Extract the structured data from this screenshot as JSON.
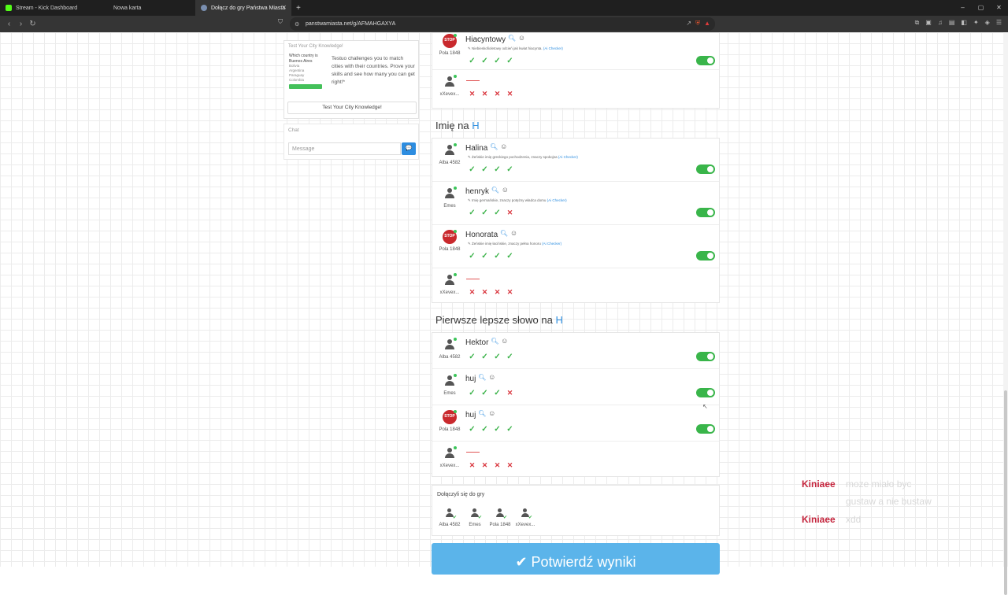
{
  "browser": {
    "tabs": [
      {
        "title": "Stream - Kick Dashboard",
        "favicon_color": "#53fc18"
      },
      {
        "title": "Nowa karta",
        "favicon_color": ""
      },
      {
        "title": "Dołącz do gry Państwa Miasta",
        "favicon_color": "#7a8fb0"
      }
    ],
    "new_tab": "+",
    "url": "panstwamiasta.net/g/AFMAHGAXYA",
    "window_controls": [
      "–",
      "▢",
      "✕"
    ]
  },
  "promo": {
    "title": "Test Your City Knowledge!",
    "thumb_question": "Which country is Buenos Aires",
    "thumb_options": [
      "Bolivia",
      "Argentina",
      "Paraguay",
      "Colombia"
    ],
    "description": "Testuo challenges you to match cities with their countries. Prove your skills and see how many you can get right!*",
    "button": "Test Your City Knowledge!"
  },
  "chat": {
    "title": "Chat",
    "placeholder": "Message",
    "send_icon": "💬"
  },
  "sections": [
    {
      "title": "",
      "letter": "",
      "rows": [
        {
          "player": "Pola 1848",
          "avatar": "stop",
          "word": "Hiacyntowy",
          "description": "Niebieskofioletowy odcień jak kwiat hiacynta.",
          "ai": "(Ai Checker)",
          "marks": [
            "ok",
            "ok",
            "ok",
            "ok"
          ],
          "toggle": true
        },
        {
          "player": "xXevex...",
          "avatar": "user",
          "word": "",
          "description": "",
          "ai": "",
          "marks": [
            "no",
            "no",
            "no",
            "no"
          ],
          "toggle": false
        }
      ]
    },
    {
      "title": "Imię na ",
      "letter": "H",
      "rows": [
        {
          "player": "Alba 4582",
          "avatar": "user",
          "word": "Halina",
          "description": "Żeńskie imię greckiego pochodzenia, znaczy spokojna",
          "ai": "(Ai Checker)",
          "marks": [
            "ok",
            "ok",
            "ok",
            "ok"
          ],
          "toggle": true
        },
        {
          "player": "Emes",
          "avatar": "user",
          "word": "henryk",
          "description": "Imię germańskie, znaczy potężny władca domu",
          "ai": "(Ai Checker)",
          "marks": [
            "ok",
            "ok",
            "ok",
            "no"
          ],
          "toggle": true
        },
        {
          "player": "Pola 1848",
          "avatar": "stop",
          "word": "Honorata",
          "description": "Żeńskie imię łacińskie, znaczy pełna honoru",
          "ai": "(Ai Checker)",
          "marks": [
            "ok",
            "ok",
            "ok",
            "ok"
          ],
          "toggle": true
        },
        {
          "player": "xXevex...",
          "avatar": "user",
          "word": "",
          "description": "",
          "ai": "",
          "marks": [
            "no",
            "no",
            "no",
            "no"
          ],
          "toggle": false
        }
      ]
    },
    {
      "title": "Pierwsze lepsze słowo na ",
      "letter": "H",
      "rows": [
        {
          "player": "Alba 4582",
          "avatar": "user",
          "word": "Hektor",
          "description": "",
          "ai": "",
          "marks": [
            "ok",
            "ok",
            "ok",
            "ok"
          ],
          "toggle": true
        },
        {
          "player": "Emes",
          "avatar": "user",
          "word": "huj",
          "description": "",
          "ai": "",
          "marks": [
            "ok",
            "ok",
            "ok",
            "no"
          ],
          "toggle": true
        },
        {
          "player": "Pola 1848",
          "avatar": "stop",
          "word": "huj",
          "description": "",
          "ai": "",
          "marks": [
            "ok",
            "ok",
            "ok",
            "ok"
          ],
          "toggle": true
        },
        {
          "player": "xXevex...",
          "avatar": "user",
          "word": "",
          "description": "",
          "ai": "",
          "marks": [
            "no",
            "no",
            "no",
            "no"
          ],
          "toggle": false
        }
      ]
    }
  ],
  "joined": {
    "title": "Dołączyli się do gry",
    "players": [
      "Alba 4582",
      "Emes",
      "Pola 1848",
      "xXevex..."
    ]
  },
  "confirm_button": "✔ Potwierdź wyniki",
  "stream_chat": [
    {
      "user": "Kiniaee",
      "lines": [
        "moze miało byc",
        "gustaw a nie bustaw"
      ]
    },
    {
      "user": "Kiniaee",
      "lines": [
        "xdd"
      ]
    }
  ],
  "colors": {
    "accent": "#2f8fe0",
    "ok": "#3cb34a",
    "no": "#d9363e",
    "toggle": "#39b54a",
    "confirm": "#5bb4ea",
    "chat_user": "#c4243c"
  },
  "icons": {
    "search": "search-icon",
    "feedback": "smiley-icon",
    "ok": "check-icon",
    "no": "cross-icon"
  }
}
